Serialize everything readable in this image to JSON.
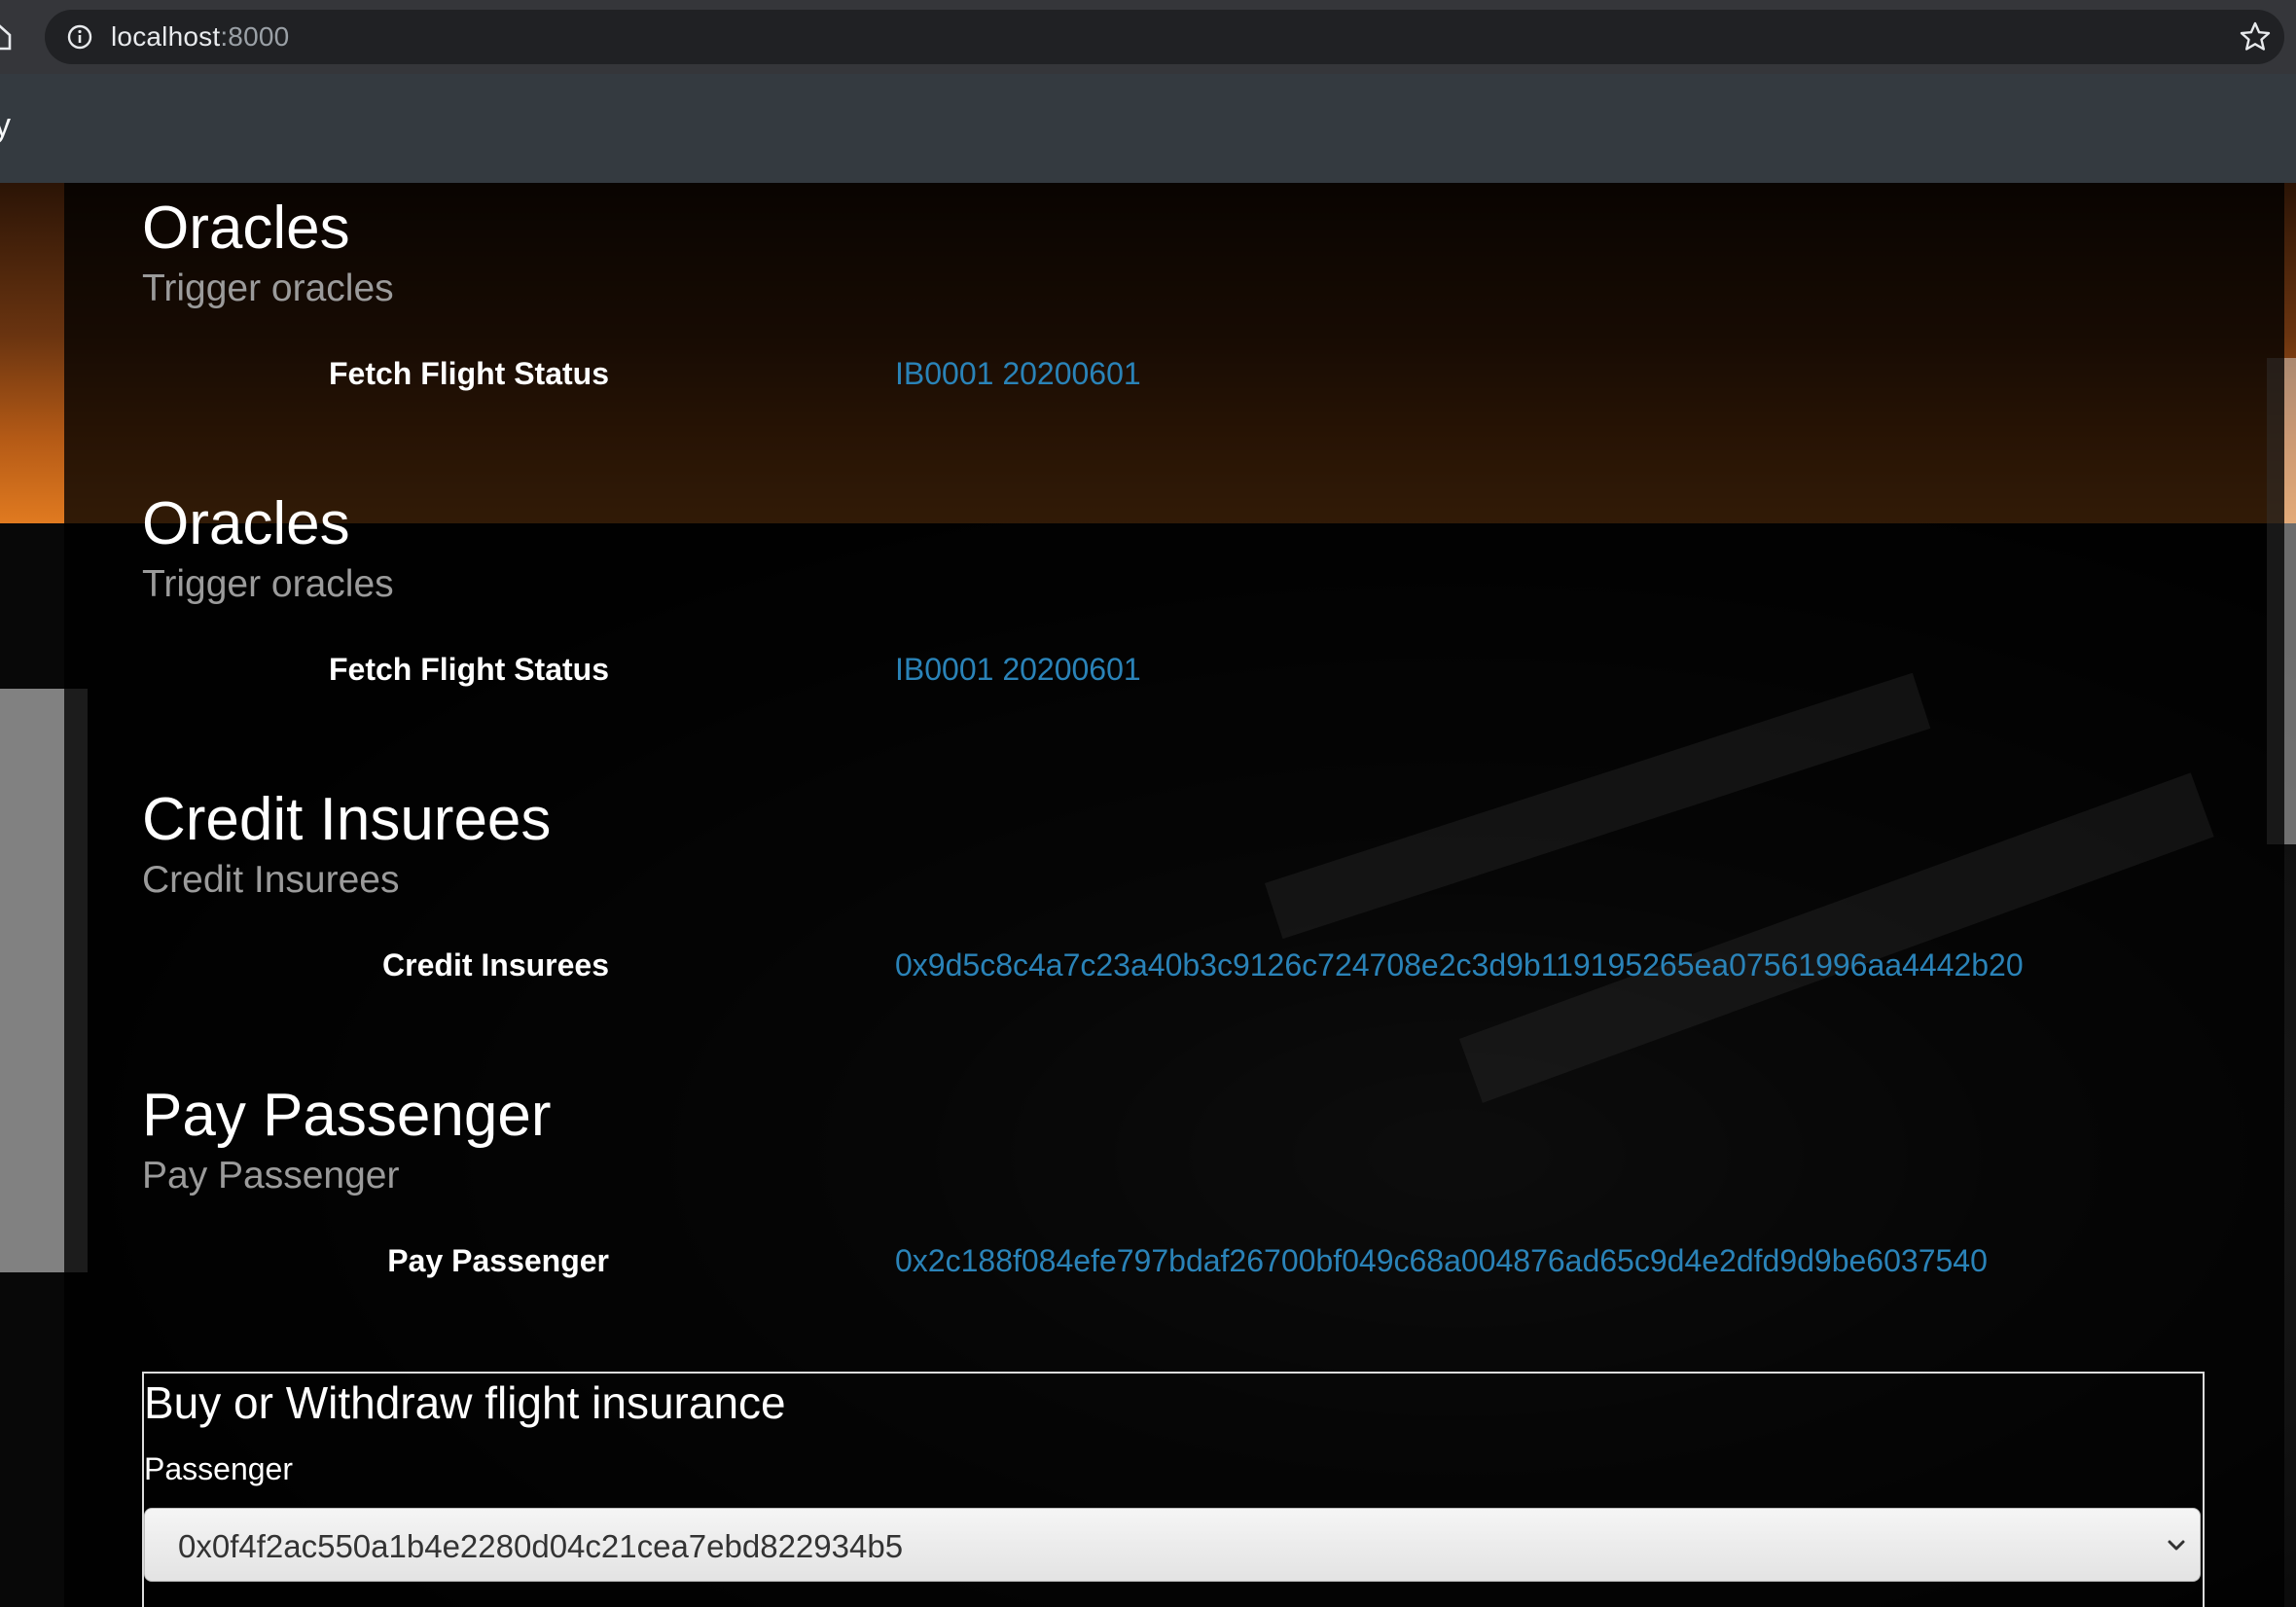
{
  "browser": {
    "url_host": "localhost",
    "url_port": ":8000",
    "icons": [
      "home-icon",
      "info-icon",
      "star-icon"
    ]
  },
  "navbar": {
    "brand_fragment": "y"
  },
  "sections": [
    {
      "title": "Oracles",
      "subtitle": "Trigger oracles",
      "label": "Fetch Flight Status",
      "value": "IB0001 20200601"
    },
    {
      "title": "Oracles",
      "subtitle": "Trigger oracles",
      "label": "Fetch Flight Status",
      "value": "IB0001 20200601"
    },
    {
      "title": "Credit Insurees",
      "subtitle": "Credit Insurees",
      "label": "Credit Insurees",
      "value": "0x9d5c8c4a7c23a40b3c9126c724708e2c3d9b119195265ea07561996aa4442b20"
    },
    {
      "title": "Pay Passenger",
      "subtitle": "Pay Passenger",
      "label": "Pay Passenger",
      "value": "0x2c188f084efe797bdaf26700bf049c68a004876ad65c9d4e2dfd9d9be6037540"
    }
  ],
  "insurance_form": {
    "title": "Buy or Withdraw flight insurance",
    "passenger_label": "Passenger",
    "passenger_selected": "0x0f4f2ac550a1b4e2280d04c21cea7ebd822934b5"
  },
  "colors": {
    "link": "#2a83b8",
    "navbar": "#343a40",
    "chrome": "#35363a"
  }
}
